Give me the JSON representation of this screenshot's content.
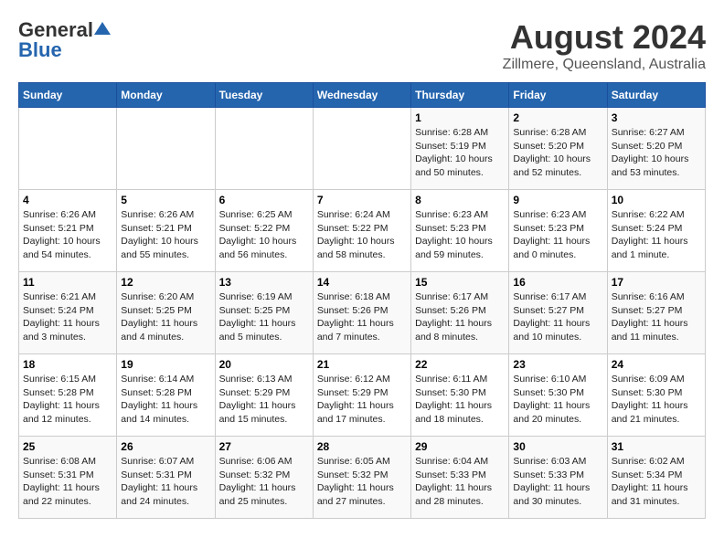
{
  "logo": {
    "general": "General",
    "blue": "Blue"
  },
  "title": "August 2024",
  "subtitle": "Zillmere, Queensland, Australia",
  "days_of_week": [
    "Sunday",
    "Monday",
    "Tuesday",
    "Wednesday",
    "Thursday",
    "Friday",
    "Saturday"
  ],
  "weeks": [
    [
      {
        "day": "",
        "info": ""
      },
      {
        "day": "",
        "info": ""
      },
      {
        "day": "",
        "info": ""
      },
      {
        "day": "",
        "info": ""
      },
      {
        "day": "1",
        "info": "Sunrise: 6:28 AM\nSunset: 5:19 PM\nDaylight: 10 hours\nand 50 minutes."
      },
      {
        "day": "2",
        "info": "Sunrise: 6:28 AM\nSunset: 5:20 PM\nDaylight: 10 hours\nand 52 minutes."
      },
      {
        "day": "3",
        "info": "Sunrise: 6:27 AM\nSunset: 5:20 PM\nDaylight: 10 hours\nand 53 minutes."
      }
    ],
    [
      {
        "day": "4",
        "info": "Sunrise: 6:26 AM\nSunset: 5:21 PM\nDaylight: 10 hours\nand 54 minutes."
      },
      {
        "day": "5",
        "info": "Sunrise: 6:26 AM\nSunset: 5:21 PM\nDaylight: 10 hours\nand 55 minutes."
      },
      {
        "day": "6",
        "info": "Sunrise: 6:25 AM\nSunset: 5:22 PM\nDaylight: 10 hours\nand 56 minutes."
      },
      {
        "day": "7",
        "info": "Sunrise: 6:24 AM\nSunset: 5:22 PM\nDaylight: 10 hours\nand 58 minutes."
      },
      {
        "day": "8",
        "info": "Sunrise: 6:23 AM\nSunset: 5:23 PM\nDaylight: 10 hours\nand 59 minutes."
      },
      {
        "day": "9",
        "info": "Sunrise: 6:23 AM\nSunset: 5:23 PM\nDaylight: 11 hours\nand 0 minutes."
      },
      {
        "day": "10",
        "info": "Sunrise: 6:22 AM\nSunset: 5:24 PM\nDaylight: 11 hours\nand 1 minute."
      }
    ],
    [
      {
        "day": "11",
        "info": "Sunrise: 6:21 AM\nSunset: 5:24 PM\nDaylight: 11 hours\nand 3 minutes."
      },
      {
        "day": "12",
        "info": "Sunrise: 6:20 AM\nSunset: 5:25 PM\nDaylight: 11 hours\nand 4 minutes."
      },
      {
        "day": "13",
        "info": "Sunrise: 6:19 AM\nSunset: 5:25 PM\nDaylight: 11 hours\nand 5 minutes."
      },
      {
        "day": "14",
        "info": "Sunrise: 6:18 AM\nSunset: 5:26 PM\nDaylight: 11 hours\nand 7 minutes."
      },
      {
        "day": "15",
        "info": "Sunrise: 6:17 AM\nSunset: 5:26 PM\nDaylight: 11 hours\nand 8 minutes."
      },
      {
        "day": "16",
        "info": "Sunrise: 6:17 AM\nSunset: 5:27 PM\nDaylight: 11 hours\nand 10 minutes."
      },
      {
        "day": "17",
        "info": "Sunrise: 6:16 AM\nSunset: 5:27 PM\nDaylight: 11 hours\nand 11 minutes."
      }
    ],
    [
      {
        "day": "18",
        "info": "Sunrise: 6:15 AM\nSunset: 5:28 PM\nDaylight: 11 hours\nand 12 minutes."
      },
      {
        "day": "19",
        "info": "Sunrise: 6:14 AM\nSunset: 5:28 PM\nDaylight: 11 hours\nand 14 minutes."
      },
      {
        "day": "20",
        "info": "Sunrise: 6:13 AM\nSunset: 5:29 PM\nDaylight: 11 hours\nand 15 minutes."
      },
      {
        "day": "21",
        "info": "Sunrise: 6:12 AM\nSunset: 5:29 PM\nDaylight: 11 hours\nand 17 minutes."
      },
      {
        "day": "22",
        "info": "Sunrise: 6:11 AM\nSunset: 5:30 PM\nDaylight: 11 hours\nand 18 minutes."
      },
      {
        "day": "23",
        "info": "Sunrise: 6:10 AM\nSunset: 5:30 PM\nDaylight: 11 hours\nand 20 minutes."
      },
      {
        "day": "24",
        "info": "Sunrise: 6:09 AM\nSunset: 5:30 PM\nDaylight: 11 hours\nand 21 minutes."
      }
    ],
    [
      {
        "day": "25",
        "info": "Sunrise: 6:08 AM\nSunset: 5:31 PM\nDaylight: 11 hours\nand 22 minutes."
      },
      {
        "day": "26",
        "info": "Sunrise: 6:07 AM\nSunset: 5:31 PM\nDaylight: 11 hours\nand 24 minutes."
      },
      {
        "day": "27",
        "info": "Sunrise: 6:06 AM\nSunset: 5:32 PM\nDaylight: 11 hours\nand 25 minutes."
      },
      {
        "day": "28",
        "info": "Sunrise: 6:05 AM\nSunset: 5:32 PM\nDaylight: 11 hours\nand 27 minutes."
      },
      {
        "day": "29",
        "info": "Sunrise: 6:04 AM\nSunset: 5:33 PM\nDaylight: 11 hours\nand 28 minutes."
      },
      {
        "day": "30",
        "info": "Sunrise: 6:03 AM\nSunset: 5:33 PM\nDaylight: 11 hours\nand 30 minutes."
      },
      {
        "day": "31",
        "info": "Sunrise: 6:02 AM\nSunset: 5:34 PM\nDaylight: 11 hours\nand 31 minutes."
      }
    ]
  ]
}
